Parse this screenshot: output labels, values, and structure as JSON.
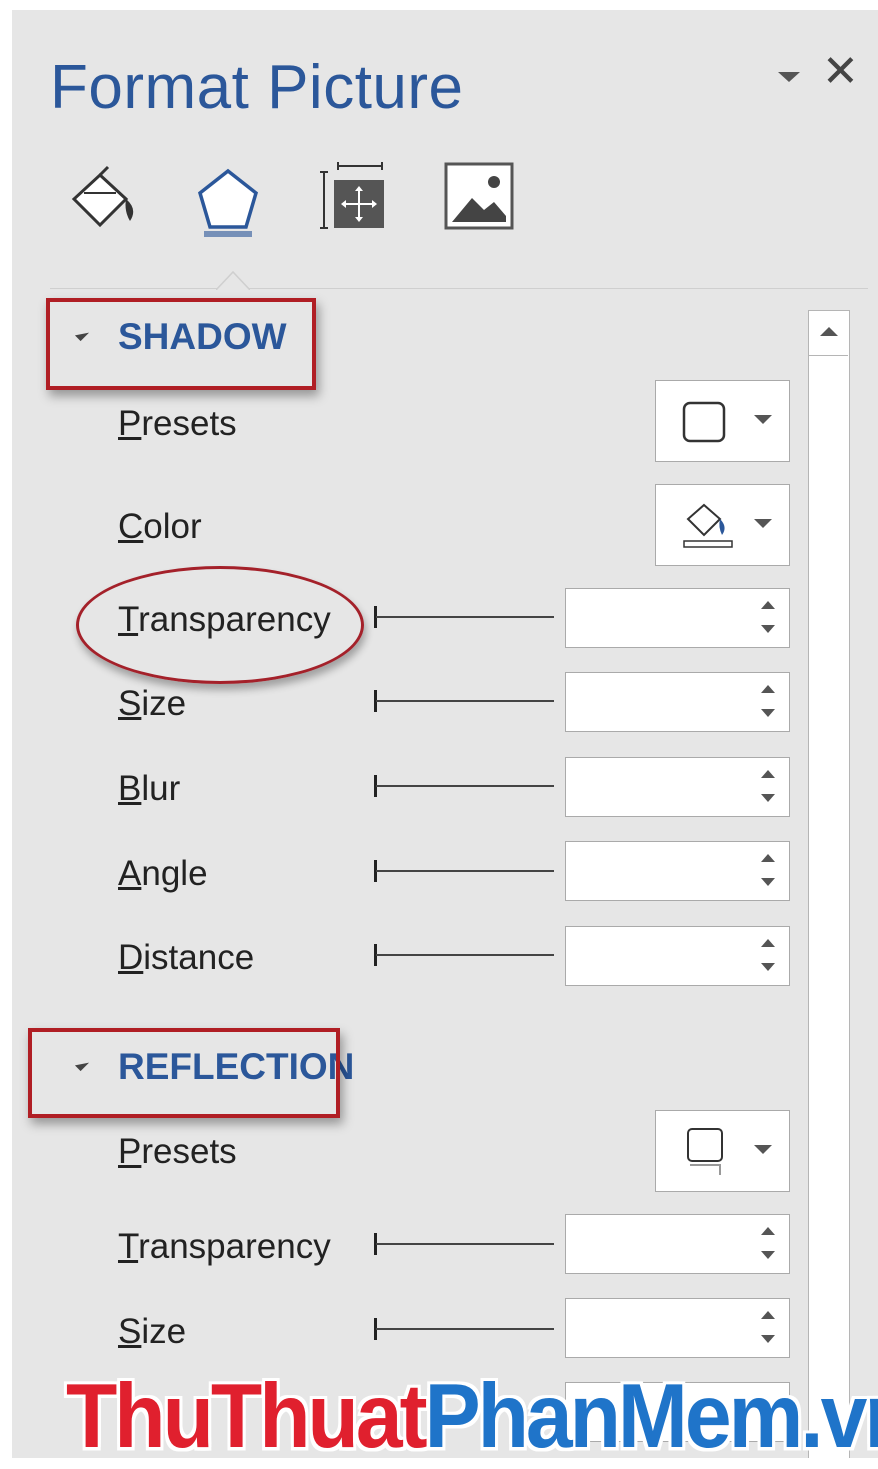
{
  "panel": {
    "title": "Format Picture"
  },
  "tabs": [
    {
      "name": "fill-line",
      "icon": "paint-bucket-icon"
    },
    {
      "name": "effects",
      "icon": "pentagon-icon"
    },
    {
      "name": "size-properties",
      "icon": "size-position-icon"
    },
    {
      "name": "picture",
      "icon": "picture-icon"
    }
  ],
  "shadow": {
    "heading": "SHADOW",
    "rows": [
      {
        "label": "Presets",
        "hotkey": "P",
        "rest": "resets"
      },
      {
        "label": "Color",
        "hotkey": "C",
        "rest": "olor"
      },
      {
        "label": "Transparency",
        "hotkey": "T",
        "rest": "ransparency",
        "value": ""
      },
      {
        "label": "Size",
        "hotkey": "S",
        "rest": "ize",
        "value": ""
      },
      {
        "label": "Blur",
        "hotkey": "B",
        "rest": "lur",
        "value": ""
      },
      {
        "label": "Angle",
        "hotkey": "A",
        "rest": "ngle",
        "value": ""
      },
      {
        "label": "Distance",
        "hotkey": "D",
        "rest": "istance",
        "value": ""
      }
    ]
  },
  "reflection": {
    "heading": "REFLECTION",
    "rows": [
      {
        "label": "Presets",
        "hotkey": "P",
        "rest": "resets"
      },
      {
        "label": "Transparency",
        "hotkey": "T",
        "rest": "ransparency",
        "value": ""
      },
      {
        "label": "Size",
        "hotkey": "S",
        "rest": "ize",
        "value": ""
      }
    ]
  },
  "watermark": {
    "part1": "ThuThuat",
    "part2": "PhanMem.vn"
  },
  "colors": {
    "accent": "#2b579a",
    "highlight_red": "#b01e24",
    "pane_bg": "#e6e6e6"
  }
}
